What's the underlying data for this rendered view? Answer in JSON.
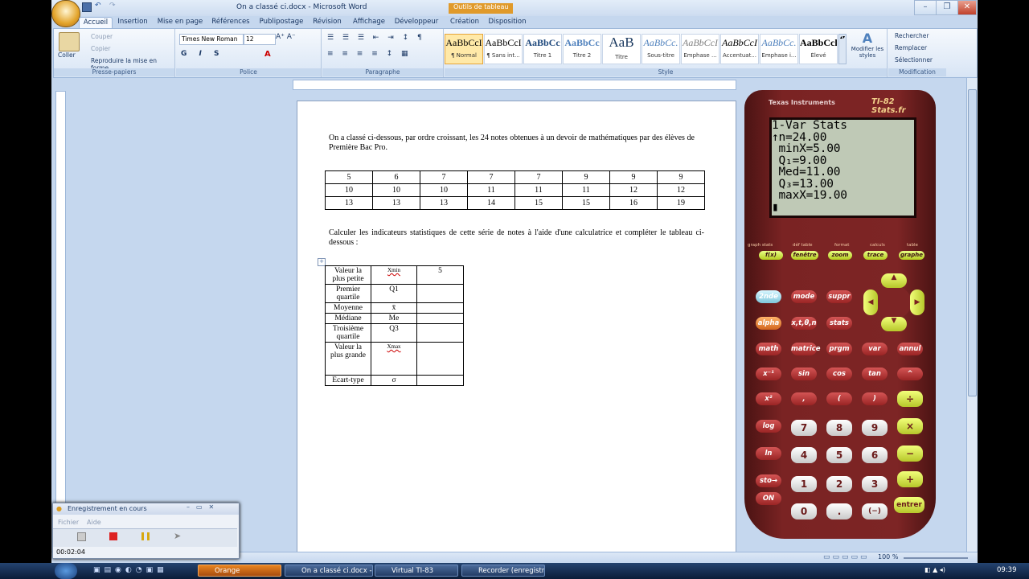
{
  "window": {
    "title": "On a classé ci.docx - Microsoft Word",
    "context_tab": "Outils de tableau"
  },
  "tabs": [
    "Accueil",
    "Insertion",
    "Mise en page",
    "Références",
    "Publipostage",
    "Révision",
    "Affichage",
    "Développeur",
    "Création",
    "Disposition"
  ],
  "ribbon": {
    "clipboard": {
      "paste": "Coller",
      "cut": "Couper",
      "copy": "Copier",
      "format_painter": "Reproduire la mise en forme",
      "label": "Presse-papiers"
    },
    "font": {
      "name": "Times New Roman",
      "size": "12",
      "label": "Police"
    },
    "paragraph": {
      "label": "Paragraphe"
    },
    "styles": {
      "label": "Style",
      "items": [
        {
          "preview": "AaBbCcI",
          "name": "¶ Normal"
        },
        {
          "preview": "AaBbCcI",
          "name": "¶ Sans int..."
        },
        {
          "preview": "AaBbCc",
          "name": "Titre 1"
        },
        {
          "preview": "AaBbCc",
          "name": "Titre 2"
        },
        {
          "preview": "AaB",
          "name": "Titre"
        },
        {
          "preview": "AaBbCc.",
          "name": "Sous-titre"
        },
        {
          "preview": "AaBbCcI",
          "name": "Emphase ..."
        },
        {
          "preview": "AaBbCcI",
          "name": "Accentuat..."
        },
        {
          "preview": "AaBbCc.",
          "name": "Emphase i..."
        },
        {
          "preview": "AaBbCcl",
          "name": "Élevé"
        }
      ],
      "modify": "Modifier les styles"
    },
    "editing": {
      "find": "Rechercher",
      "replace": "Remplacer",
      "select": "Sélectionner",
      "label": "Modification"
    }
  },
  "document": {
    "para1": "On a classé ci-dessous, par ordre croissant, les 24 notes obtenues à un devoir de mathématiques par des élèves de Première Bac Pro.",
    "notes": [
      [
        "5",
        "6",
        "7",
        "7",
        "7",
        "9",
        "9",
        "9"
      ],
      [
        "10",
        "10",
        "10",
        "11",
        "11",
        "11",
        "12",
        "12"
      ],
      [
        "13",
        "13",
        "13",
        "14",
        "15",
        "15",
        "16",
        "19"
      ]
    ],
    "para2": "Calculer les indicateurs statistiques de cette série de notes à l'aide d'une calculatrice et compléter le tableau ci-dessous :",
    "stats_rows": [
      {
        "label": "Valeur la plus petite",
        "symbol": "Xmin",
        "value": "5"
      },
      {
        "label": "Premier quartile",
        "symbol": "Q1",
        "value": ""
      },
      {
        "label": "Moyenne",
        "symbol": "x̄",
        "value": ""
      },
      {
        "label": "Médiane",
        "symbol": "Me",
        "value": ""
      },
      {
        "label": "Troisième quartile",
        "symbol": "Q3",
        "value": ""
      },
      {
        "label": "Valeur la plus grande",
        "symbol": "Xmax",
        "value": ""
      },
      {
        "label": "Ecart-type",
        "symbol": "σ",
        "value": ""
      }
    ]
  },
  "statusbar": {
    "zoom": "100 %"
  },
  "calculator": {
    "brand": "Texas Instruments",
    "model": "TI-82 Stats.fr",
    "screen": [
      "1-Var Stats",
      "↑n=24.00",
      " minX=5.00",
      " Q₁=9.00",
      " Med=11.00",
      " Q₃=13.00",
      " maxX=19.00",
      "▮"
    ],
    "top_keys": [
      "f(x)",
      "fenêtre",
      "zoom",
      "trace",
      "graphe"
    ],
    "top_small": [
      "graph stats",
      "déf table",
      "format",
      "calculs",
      "table"
    ],
    "row1": [
      "2nde",
      "mode",
      "suppr"
    ],
    "row2": [
      "alpha",
      "x,t,θ,n",
      "stats"
    ],
    "row3": [
      "math",
      "matrice",
      "prgm",
      "var",
      "annul"
    ],
    "row4": [
      "x⁻¹",
      "sin",
      "cos",
      "tan",
      "^"
    ],
    "row5": [
      "x²",
      ",",
      "(",
      ")",
      "÷"
    ],
    "row6": [
      "log",
      "7",
      "8",
      "9",
      "×"
    ],
    "row7": [
      "ln",
      "4",
      "5",
      "6",
      "−"
    ],
    "row8": [
      "sto→",
      "1",
      "2",
      "3",
      "+"
    ],
    "row9": [
      "ON",
      "0",
      ".",
      "(−)",
      "entrer"
    ]
  },
  "recorder": {
    "title": "Enregistrement en cours",
    "menu": [
      "Fichier",
      "Aide"
    ],
    "time": "00:02:04"
  },
  "taskbar": {
    "items": [
      "Orange",
      "On a classé ci.docx -...",
      "Virtual TI-83",
      "Recorder (enregistre..."
    ],
    "clock": "09:39"
  }
}
